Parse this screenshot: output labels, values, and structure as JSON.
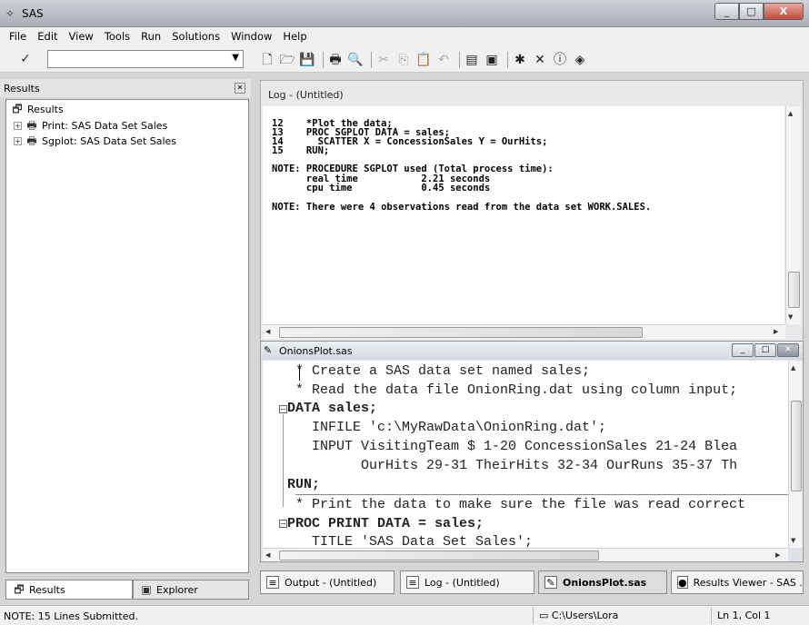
{
  "window": {
    "title": "SAS"
  },
  "menu": [
    "File",
    "Edit",
    "View",
    "Tools",
    "Run",
    "Solutions",
    "Window",
    "Help"
  ],
  "results_pane": {
    "title": "Results",
    "tree": {
      "root": "Results",
      "items": [
        "Print:  SAS Data Set Sales",
        "Sgplot:  SAS Data Set Sales"
      ]
    },
    "tabs": [
      "Results",
      "Explorer"
    ]
  },
  "log_window": {
    "title": "Log - (Untitled)",
    "lines": [
      "12    *Plot the data;",
      "13    PROC SGPLOT DATA = sales;",
      "14      SCATTER X = ConcessionSales Y = OurHits;",
      "15    RUN;",
      "",
      "NOTE: PROCEDURE SGPLOT used (Total process time):",
      "      real time           2.21 seconds",
      "      cpu time            0.45 seconds",
      "",
      "NOTE: There were 4 observations read from the data set WORK.SALES."
    ]
  },
  "program_window": {
    "title": "OnionsPlot.sas",
    "lines": [
      "    * Create a SAS data set named sales;",
      "    * Read the data file OnionRing.dat using column input;",
      "   DATA sales;",
      "      INFILE 'c:\\MyRawData\\OnionRing.dat';",
      "      INPUT VisitingTeam $ 1-20 ConcessionSales 21-24 Blea",
      "            OurHits 29-31 TheirHits 32-34 OurRuns 35-37 Th",
      "   RUN;",
      "    * Print the data to make sure the file was read correct",
      "   PROC PRINT DATA = sales;",
      "      TITLE 'SAS Data Set Sales';"
    ]
  },
  "window_tabs": [
    "Output - (Untitled)",
    "Log - (Untitled)",
    "OnionsPlot.sas",
    "Results Viewer - SAS ..."
  ],
  "status": {
    "message": "NOTE: 15 Lines Submitted.",
    "path": "C:\\Users\\Lora",
    "position": "Ln 1, Col 1"
  }
}
